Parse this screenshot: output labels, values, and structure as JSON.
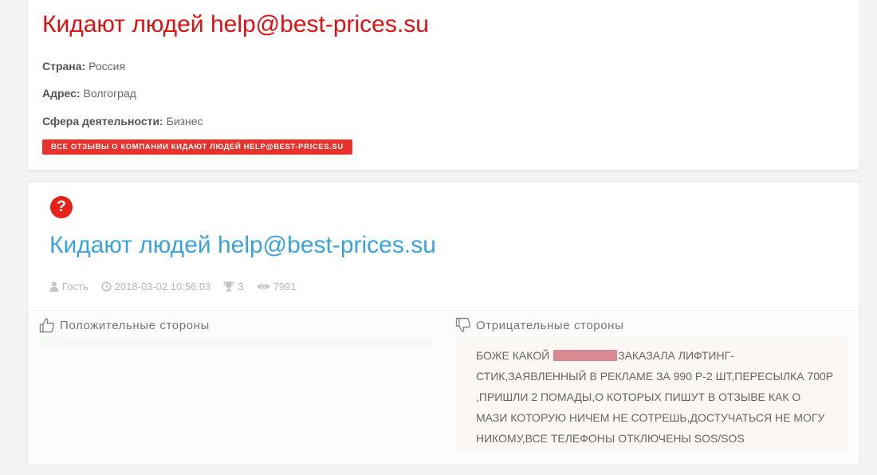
{
  "company": {
    "title": "Кидают людей help@best-prices.su",
    "country_label": "Страна:",
    "country_value": "Россия",
    "address_label": "Адрес:",
    "address_value": "Волгоград",
    "sphere_label": "Сфера деятельности:",
    "sphere_value": "Бизнес",
    "all_reviews_button": "Все отзывы о компании Кидают людей help@best-prices.su"
  },
  "review": {
    "status_icon": "question-icon",
    "status_icon_glyph": "?",
    "title": "Кидают людей help@best-prices.su",
    "author": "Гость",
    "date": "2018-03-02 10:56:03",
    "rating": "3",
    "views": "7991",
    "pros_heading": "Положительные стороны",
    "cons_heading": "Отрицательные стороны",
    "cons_text_before": "БОЖЕ КАКОЙ ",
    "cons_text_after": "ЗАКАЗАЛА ЛИФТИНГ-СТИК,ЗАЯВЛЕННЫЙ В РЕКЛАМЕ ЗА 990 Р-2 ШТ,ПЕРЕСЫЛКА 700Р ,ПРИШЛИ 2 ПОМАДЫ,О КОТОРЫХ ПИШУТ В ОТЗЫВЕ КАК О МАЗИ КОТОРУЮ НИЧЕМ НЕ СОТРЕШЬ,ДОСТУЧАТЬСЯ НЕ МОГУ НИКОМУ,ВСЕ ТЕЛЕФОНЫ ОТКЛЮЧЕНЫ SOS/SOS"
  },
  "colors": {
    "company_title": "#e01010",
    "review_title": "#3aa3dd",
    "button_bg": "#e8332c",
    "redaction": "#d98a90"
  }
}
